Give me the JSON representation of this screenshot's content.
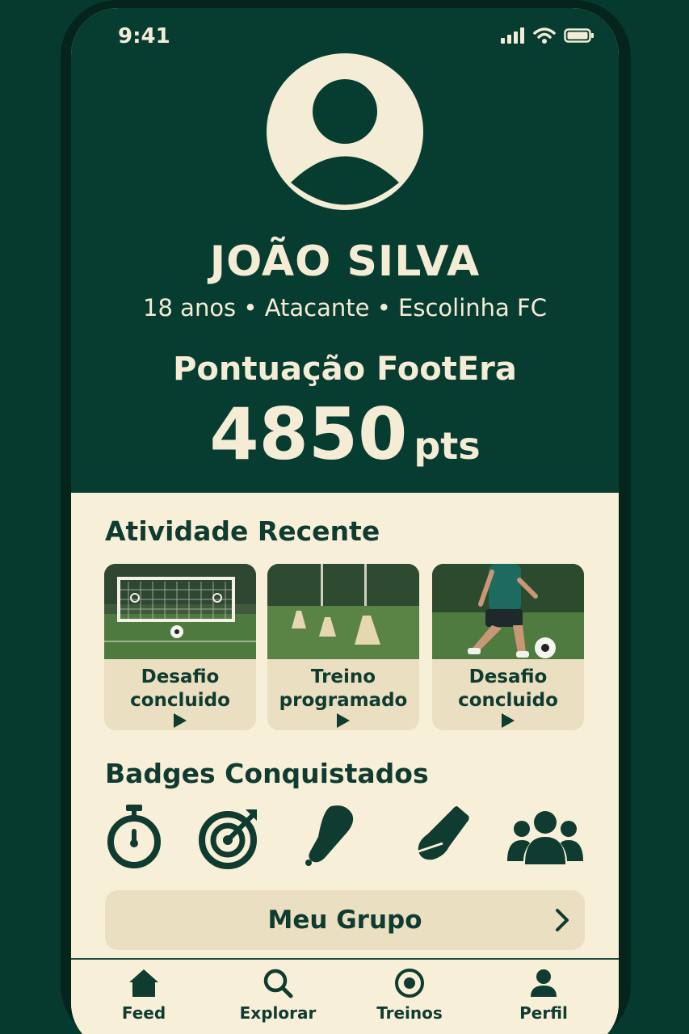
{
  "status_bar": {
    "time": "9:41"
  },
  "profile": {
    "name": "JOÃO SILVA",
    "details": "18 anos • Atacante • Escolinha FC",
    "score_label": "Pontuação FootEra",
    "score_value": "4850",
    "score_unit": "pts"
  },
  "activity": {
    "title": "Atividade Recente",
    "items": [
      {
        "label_line1": "Desafio",
        "label_line2": "concluido",
        "image": "soccer-goal"
      },
      {
        "label_line1": "Treino",
        "label_line2": "programado",
        "image": "training-cones"
      },
      {
        "label_line1": "Desafio",
        "label_line2": "concluido",
        "image": "player-kicking-ball"
      }
    ]
  },
  "badges": {
    "title": "Badges Conquistados",
    "items": [
      "stopwatch-icon",
      "target-icon",
      "cleat-icon",
      "whistle-icon",
      "team-icon"
    ]
  },
  "group_button": {
    "label": "Meu Grupo"
  },
  "tab_bar": {
    "tabs": [
      {
        "label": "Feed",
        "icon": "home-icon"
      },
      {
        "label": "Explorar",
        "icon": "search-icon"
      },
      {
        "label": "Treinos",
        "icon": "target-icon"
      },
      {
        "label": "Perfil",
        "icon": "user-icon"
      }
    ]
  },
  "colors": {
    "primary_dark": "#073d30",
    "cream": "#f8efd8",
    "card": "#eadfc0",
    "text_dark": "#0f3b31"
  }
}
